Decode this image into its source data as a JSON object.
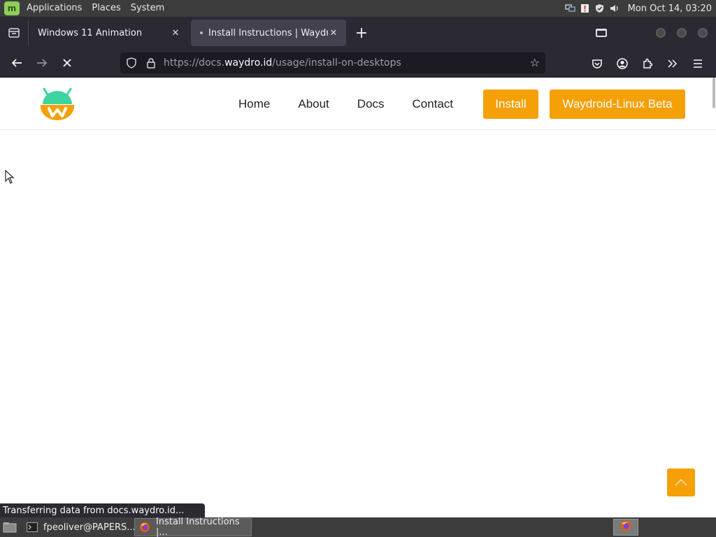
{
  "top_panel": {
    "menus": [
      "Applications",
      "Places",
      "System"
    ],
    "clock": "Mon Oct 14, 03:20"
  },
  "tabs": [
    {
      "title": "Windows 11 Animation",
      "active": false
    },
    {
      "title": "Install Instructions | Waydro",
      "active": true
    }
  ],
  "navbar": {
    "url_prefix": "https://docs.",
    "url_host": "waydro.id",
    "url_path": "/usage/install-on-desktops"
  },
  "site": {
    "nav": [
      "Home",
      "About",
      "Docs",
      "Contact"
    ],
    "install_label": "Install",
    "beta_label": "Waydroid-Linux Beta",
    "brand_color": "#f5a006"
  },
  "status_text": "Transferring data from docs.waydro.id...",
  "taskbar": {
    "tasks": [
      {
        "label": "fpeoliver@PAPERS...",
        "icon": "terminal-icon"
      },
      {
        "label": "Install Instructions |...",
        "icon": "firefox-icon"
      }
    ]
  }
}
